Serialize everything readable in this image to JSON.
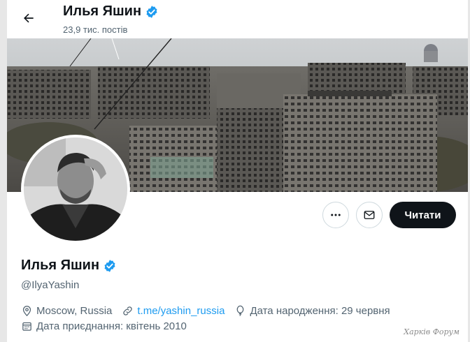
{
  "header": {
    "name": "Илья Яшин",
    "post_count": "23,9 тис. постів"
  },
  "actions": {
    "follow_label": "Читати"
  },
  "profile": {
    "name": "Илья Яшин",
    "handle": "@IlyaYashin",
    "location": "Moscow, Russia",
    "website": "t.me/yashin_russia",
    "birthday": "Дата народження: 29 червня",
    "joined": "Дата приєднання: квітень 2010"
  },
  "icons": {
    "back": "arrow-left-icon",
    "verified": "verified-badge-icon",
    "more": "more-dots-icon",
    "message": "envelope-icon",
    "location": "location-pin-icon",
    "link": "link-icon",
    "birthday": "balloon-icon",
    "calendar": "calendar-icon"
  },
  "colors": {
    "accent": "#1d9bf0",
    "text": "#0f1419",
    "muted": "#536471",
    "follow_button": "#0f1419"
  },
  "watermark": "Харків Форум"
}
